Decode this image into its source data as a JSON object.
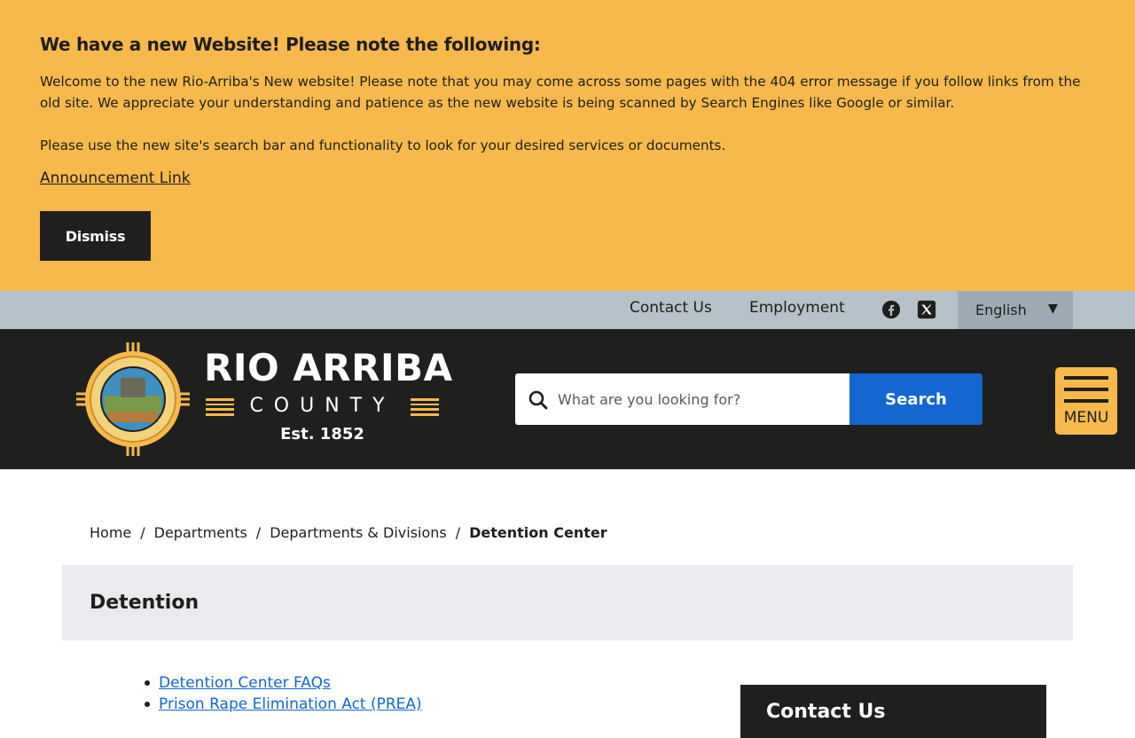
{
  "banner": {
    "title": "We have a new Website! Please note the following:",
    "paragraph1": "Welcome to the new Rio-Arriba's New website! Please note that you may come across some pages with the 404 error message if you follow links from the old site. We appreciate your understanding and patience as the new website is being scanned by Search Engines like Google or similar.",
    "paragraph2": "Please use the new site's search bar and functionality to look for your desired services or documents.",
    "link_label": "Announcement Link",
    "dismiss_label": "Dismiss"
  },
  "utility": {
    "contact_label": "Contact Us",
    "employment_label": "Employment",
    "social_icons": [
      "facebook-icon",
      "x-twitter-icon"
    ],
    "language_selected": "English"
  },
  "header": {
    "brand_name": "RIO ARRIBA",
    "brand_county": "COUNTY",
    "brand_est": "Est. 1852",
    "search_placeholder": "What are you looking for?",
    "search_button_label": "Search",
    "menu_label": "MENU"
  },
  "breadcrumb": {
    "items": [
      "Home",
      "Departments",
      "Departments & Divisions"
    ],
    "current": "Detention Center",
    "separator": "/"
  },
  "page": {
    "title": "Detention",
    "links": [
      "Detention Center FAQs",
      "Prison Rape Elimination Act (PREA)"
    ],
    "sidebar_title": "Contact Us"
  },
  "colors": {
    "banner_bg": "#f7b94c",
    "header_bg": "#1f201d",
    "utility_bg": "#b7c1c9",
    "accent_blue": "#1466d0",
    "title_band_bg": "#eaebee"
  }
}
